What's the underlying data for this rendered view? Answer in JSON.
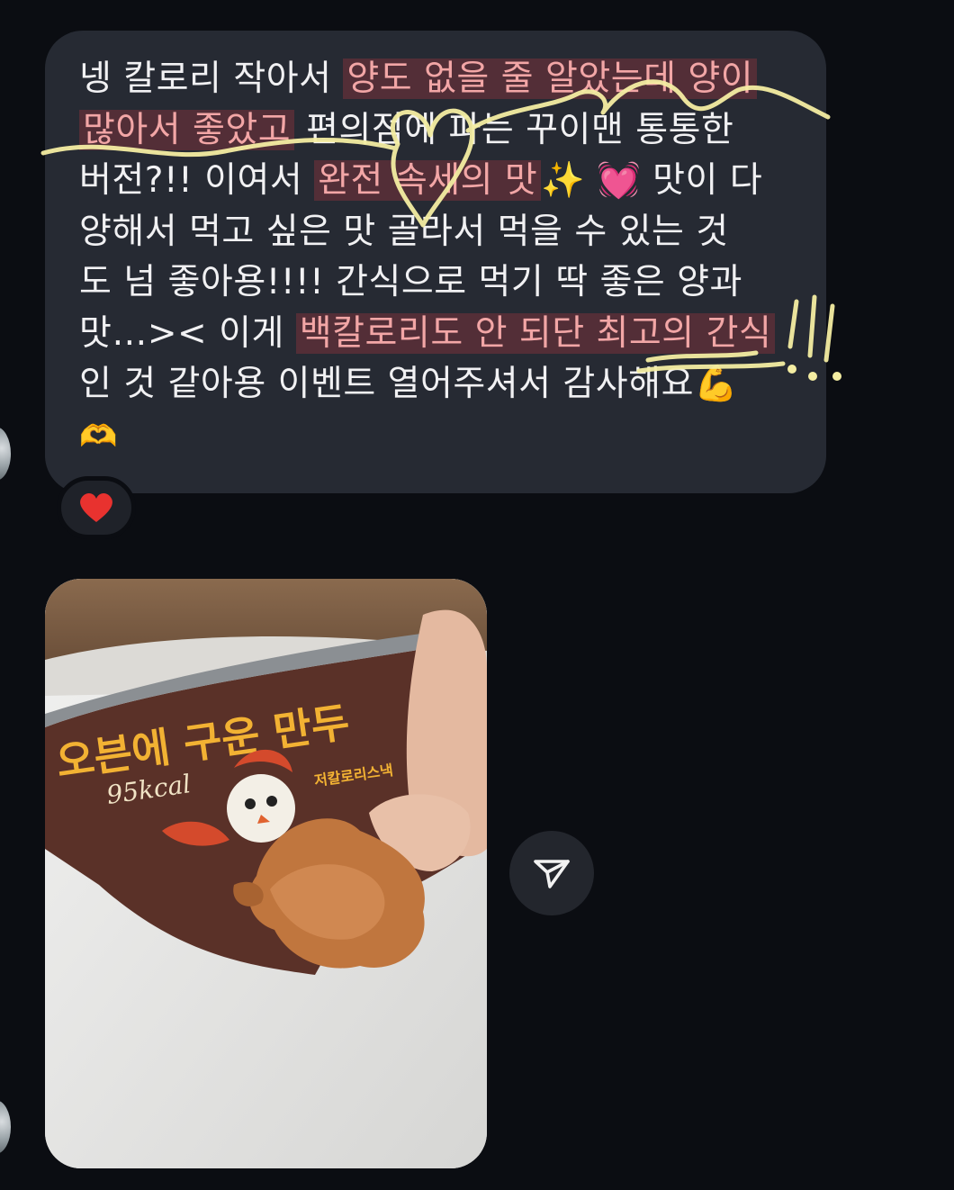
{
  "message": {
    "line1_plain": "넹 칼로리 작아서 ",
    "line1_hl": "양도 없을 줄 알았는데 양이",
    "line2_hl": "많아서 좋았고",
    "line2_plain": " 편의점에 파는 꾸이맨 통통한",
    "line3_plain_a": "버전?!! 이여서 ",
    "line3_hl": "완전 속세의 맛",
    "line3_emoji_sparkle": "✨",
    "line3_emoji_heart": "💓",
    "line3_plain_b": " 맛이 다",
    "line4": "양해서 먹고 싶은 맛 골라서 먹을 수 있는 것",
    "line5": "도 넘 좋아용!!!! 간식으로 먹기 딱 좋은 양과",
    "line6_plain": "맛…>< 이게 ",
    "line6_hl": "백칼로리도 안 되단 최고의 간식",
    "line7": "인 것 같아용 이벤트 열어주셔서 감사해요",
    "line7_emoji": "💪",
    "line8_emoji": "🫶"
  },
  "reaction": {
    "emoji": "❤️",
    "icon": "heart-icon",
    "color": "#e8322f"
  },
  "photo": {
    "package_text": "오븐에 구운 만두",
    "package_kcal": "95kcal",
    "package_sub": "저칼로리스낵"
  },
  "share_button": {
    "icon": "send-icon"
  },
  "colors": {
    "background": "#0b0d12",
    "bubble": "#262a33",
    "highlight_text": "#f2a6a6",
    "scribble": "#f4eda2"
  }
}
